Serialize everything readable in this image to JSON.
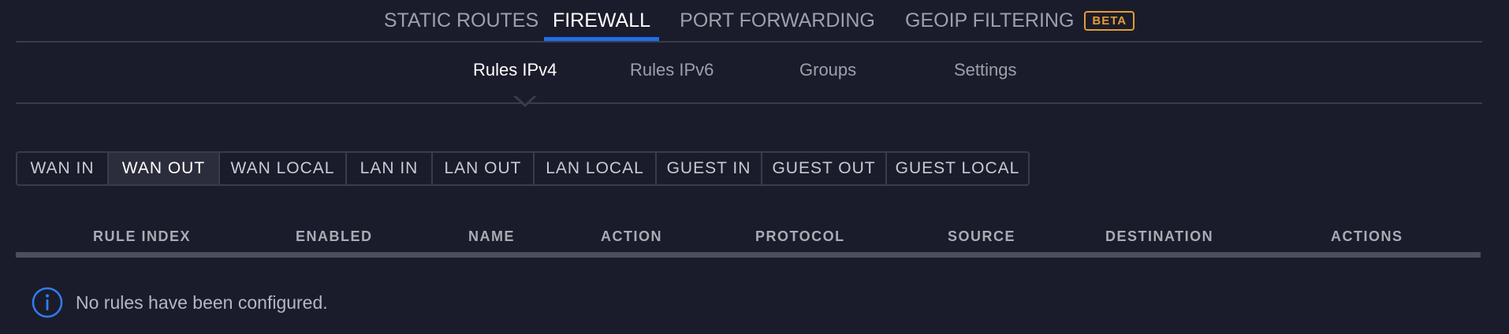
{
  "top_tabs": {
    "static_routes": "STATIC ROUTES",
    "firewall": "FIREWALL",
    "port_forwarding": "PORT FORWARDING",
    "geoip_filtering": "GEOIP FILTERING",
    "beta_badge": "BETA"
  },
  "sub_tabs": {
    "rules_ipv4": "Rules IPv4",
    "rules_ipv6": "Rules IPv6",
    "groups": "Groups",
    "settings": "Settings"
  },
  "rulesets": [
    "WAN IN",
    "WAN OUT",
    "WAN LOCAL",
    "LAN IN",
    "LAN OUT",
    "LAN LOCAL",
    "GUEST IN",
    "GUEST OUT",
    "GUEST LOCAL"
  ],
  "selected_ruleset": "WAN OUT",
  "table": {
    "columns": [
      "RULE INDEX",
      "ENABLED",
      "NAME",
      "ACTION",
      "PROTOCOL",
      "SOURCE",
      "DESTINATION",
      "ACTIONS"
    ]
  },
  "empty_state": {
    "icon": "info-circle-icon",
    "message": "No rules have been configured."
  },
  "colors": {
    "background": "#1b1c2b",
    "accent": "#1e6fe8",
    "beta": "#e39d34",
    "divider": "#3a3c4b"
  }
}
